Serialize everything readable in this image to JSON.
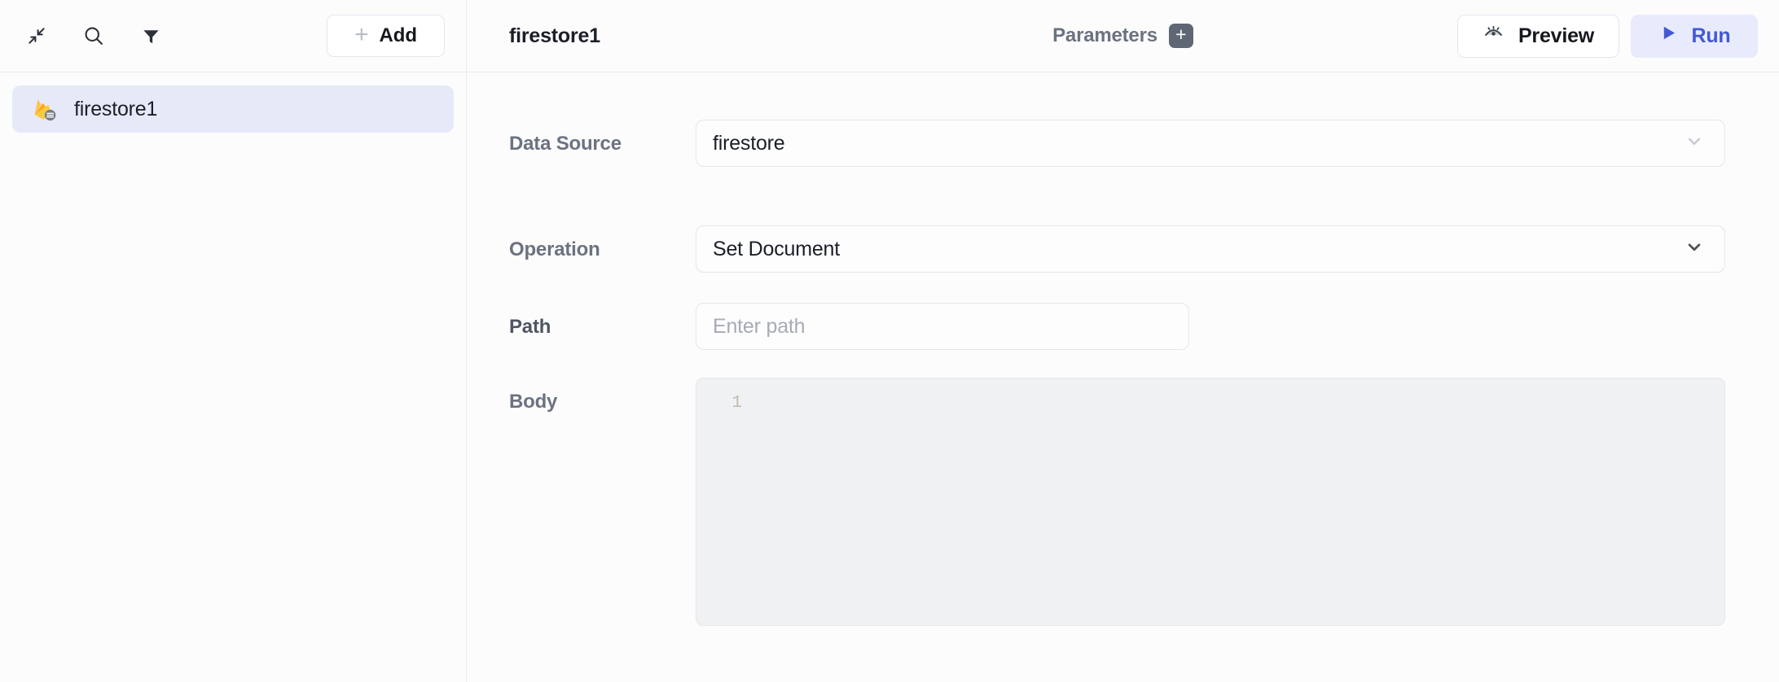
{
  "sidebar": {
    "toolbar": {
      "collapse_icon": "collapse-icon",
      "search_icon": "search-icon",
      "filter_icon": "filter-icon",
      "add_label": "Add",
      "add_plus": "+"
    },
    "items": [
      {
        "label": "firestore1",
        "icon": "firebase-firestore-icon",
        "selected": true
      }
    ]
  },
  "header": {
    "title": "firestore1",
    "parameters_label": "Parameters",
    "parameters_add": "+",
    "preview_label": "Preview",
    "preview_icon": "eye-icon",
    "run_label": "Run",
    "run_icon": "play-icon"
  },
  "form": {
    "data_source": {
      "label": "Data Source",
      "value": "firestore",
      "chevron_icon": "chevron-down-icon"
    },
    "operation": {
      "label": "Operation",
      "value": "Set Document",
      "chevron_icon": "chevron-down-icon"
    },
    "path": {
      "label": "Path",
      "value": "",
      "placeholder": "Enter path"
    },
    "body": {
      "label": "Body",
      "value": "",
      "line_numbers": [
        "1"
      ]
    }
  },
  "colors": {
    "accent": "#4359d4",
    "run_bg": "#e8ebfb",
    "selected_item_bg": "#e6eaf8",
    "border": "#e4e6eb",
    "label_gray": "#6b7280",
    "editor_bg": "#f0f1f3",
    "line_number": "#c2bbab",
    "firebase_orange": "#f5820d",
    "firebase_yellow": "#fcca3f"
  }
}
